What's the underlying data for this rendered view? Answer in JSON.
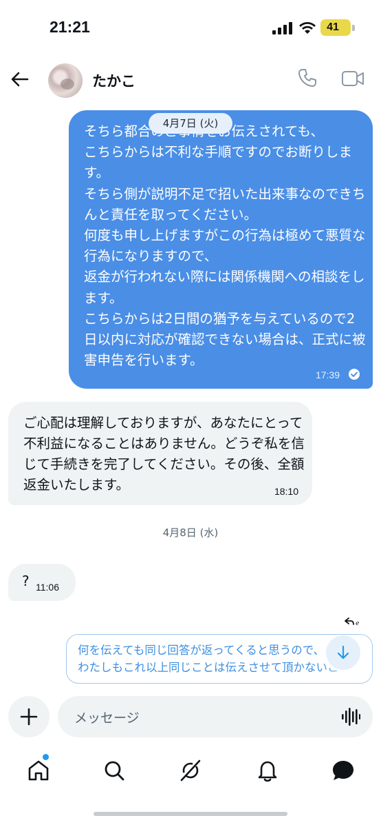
{
  "status_bar": {
    "time": "21:21",
    "battery": "41",
    "battery_color": "#e9d84a"
  },
  "header": {
    "contact_name": "たかこ",
    "icons": [
      "back-arrow-icon",
      "avatar",
      "phone-icon",
      "video-camera-icon"
    ]
  },
  "chat": {
    "date_chip": "4月7日 (火)",
    "outgoing_message": {
      "text": "そちら都合のご事情をお伝えされても、\nこちらからは不利な手順ですのでお断りします。\nそちら側が説明不足で招いた出来事なのできちんと責任を取ってください。\n何度も申し上げますがこの行為は極めて悪質な行為になりますので、\n返金が行われない際には関係機関への相談をします。\nこちらからは2日間の猶予を与えているので2日以内に対応が確認できない場合は、正式に被害申告を行います。",
      "time": "17:39",
      "status_icon": "read-check-icon",
      "bubble_color": "#4a8ee6"
    },
    "incoming_message": {
      "text": "ご心配は理解しておりますが、あなたにとって不利益になることはありません。どうぞ私を信じて手続きを完了してください。その後、全額返金いたします。",
      "time": "18:10"
    },
    "date_separator": "4月8日 (水)",
    "incoming_question": {
      "text": "?",
      "time": "11:06"
    }
  },
  "draft": {
    "line1": "何を伝えても同じ回答が返ってくると思うので、",
    "line2": "わたしもこれ以上同じことは伝えさせて頂かないこ",
    "color": "#3d8fe0"
  },
  "composer": {
    "placeholder": "メッセージ",
    "icons": [
      "add-icon",
      "voice-wave-icon"
    ]
  },
  "bottom_nav": {
    "items": [
      "home-icon",
      "search-icon",
      "grok-icon",
      "notifications-bell-icon",
      "messages-icon"
    ],
    "home_badge": true,
    "accent": "#1d9bf0"
  }
}
